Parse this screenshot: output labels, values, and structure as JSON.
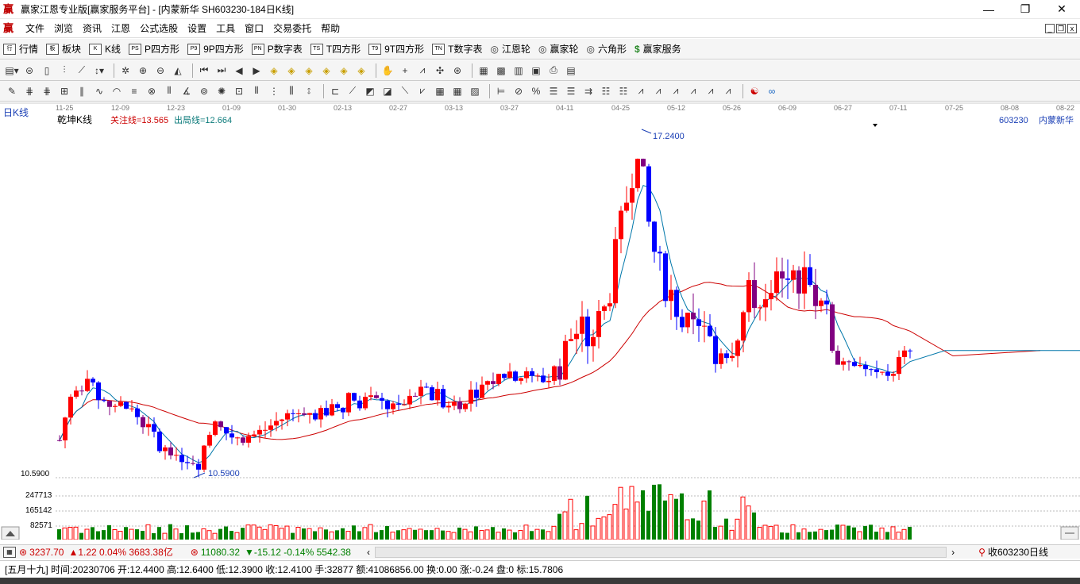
{
  "window": {
    "title": "赢家江恩专业版[赢家服务平台] - [内蒙新华  SH603230-184日K线]",
    "logo": "赢",
    "minimize": "—",
    "restore": "❐",
    "close": "✕"
  },
  "menu": {
    "logo": "赢",
    "items": [
      "文件",
      "浏览",
      "资讯",
      "江恩",
      "公式选股",
      "设置",
      "工具",
      "窗口",
      "交易委托",
      "帮助"
    ]
  },
  "toolbar1": {
    "items": [
      {
        "icon": "行",
        "label": "行情"
      },
      {
        "icon": "板",
        "label": "板块"
      },
      {
        "icon": "K",
        "label": "K线"
      },
      {
        "icon": "PS",
        "label": "P四方形"
      },
      {
        "icon": "P9",
        "label": "9P四方形"
      },
      {
        "icon": "PN",
        "label": "P数字表"
      },
      {
        "icon": "TS",
        "label": "T四方形"
      },
      {
        "icon": "T9",
        "label": "9T四方形"
      },
      {
        "icon": "TN",
        "label": "T数字表"
      },
      {
        "icon": "◎",
        "label": "江恩轮"
      },
      {
        "icon": "◎",
        "label": "赢家轮"
      },
      {
        "icon": "◎",
        "label": "六角形"
      },
      {
        "icon": "$",
        "label": "赢家服务"
      }
    ]
  },
  "chart": {
    "period_label": "日K线",
    "indicator_name": "乾坤K线",
    "focus_line": "关注线=13.565",
    "exit_line": "出局线=12.664",
    "stock_code": "603230",
    "stock_name": "内蒙新华",
    "high_label": "17.2400",
    "low_label": "10.5900",
    "low_axis_label": "10.5900",
    "date_ticks": [
      "11-25",
      "12-09",
      "12-23",
      "01-09",
      "01-30",
      "02-13",
      "02-27",
      "03-13",
      "03-27",
      "04-11",
      "04-25",
      "05-12",
      "05-26",
      "06-09",
      "06-27",
      "07-11",
      "07-25",
      "08-08",
      "08-22"
    ],
    "volume_axis": [
      "247713",
      "165142",
      "82571"
    ],
    "price_min": 10.59,
    "price_max": 17.24,
    "colors": {
      "up": "#ff0000",
      "down": "#0000ff",
      "neutral": "#800080",
      "vol_up": "#ff0000",
      "vol_down": "#008000",
      "ma_short": "#0077aa",
      "ma_long": "#cc0000"
    }
  },
  "statusbar": {
    "sh_index": "3237.70",
    "sh_change": "▲1.22 0.04% 3683.38亿",
    "sz_index": "11080.32",
    "sz_change": "▼-15.12 -0.14% 5542.38",
    "right_label": "收603230日线"
  },
  "infobar": {
    "text": "[五月十九] 时间:20230706 开:12.4400 高:12.6400 低:12.3900 收:12.4100 手:32877 额:41086856.00 换:0.00 涨:-0.24 盘:0 标:15.7806"
  }
}
